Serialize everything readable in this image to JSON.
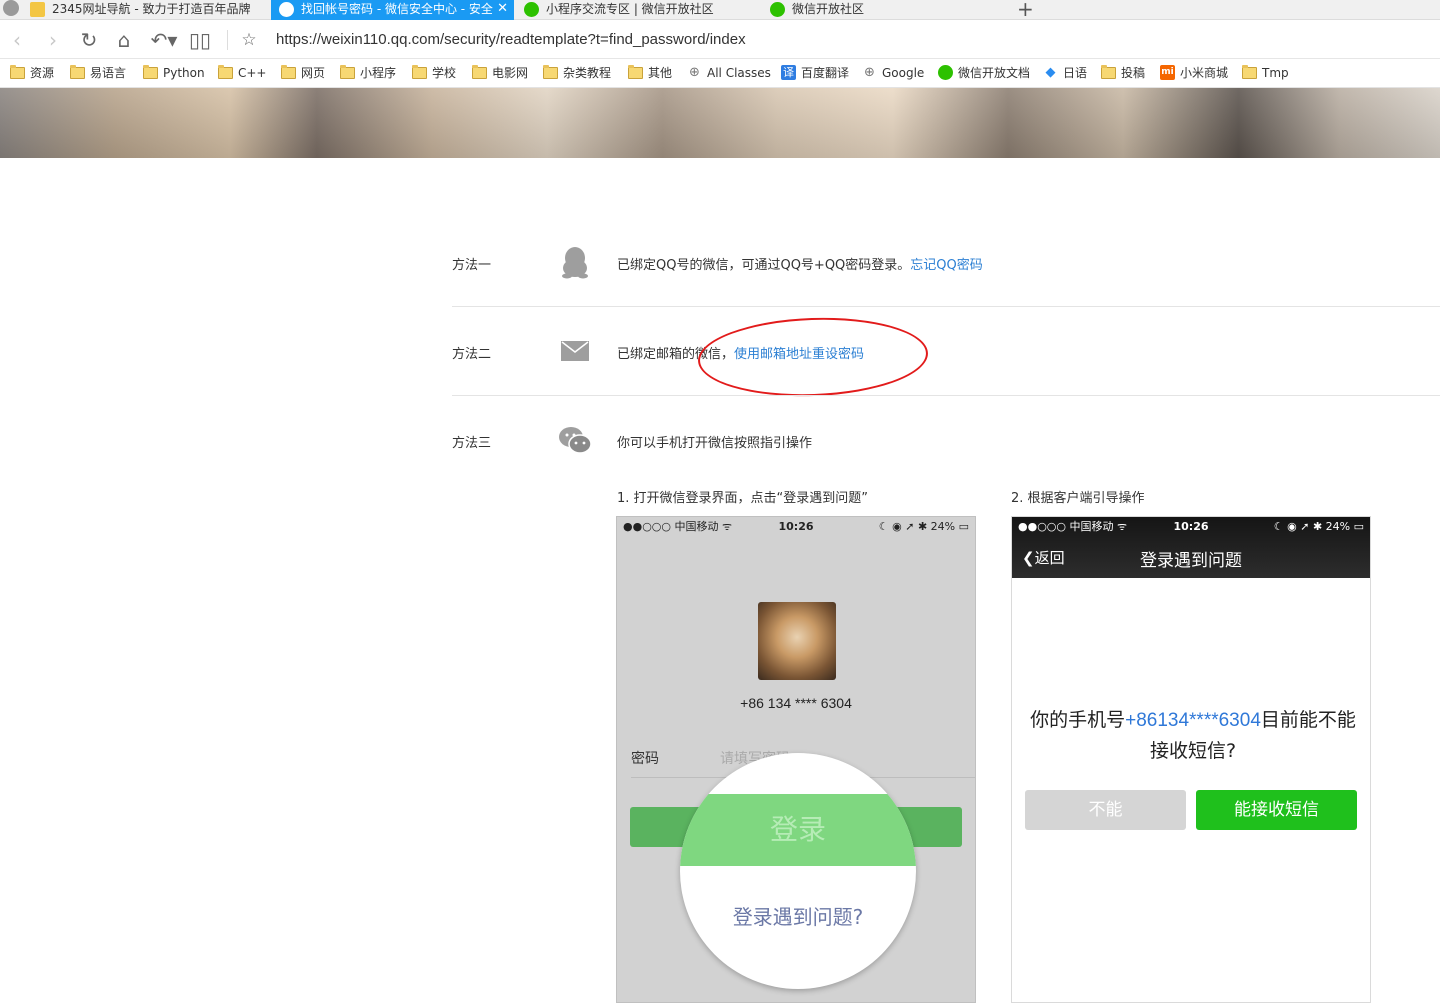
{
  "tabs": [
    {
      "title": "2345网址导航 - 致力于打造百年品牌",
      "active": false
    },
    {
      "title": "找回帐号密码 - 微信安全中心 - 安全",
      "active": true
    },
    {
      "title": "小程序交流专区 | 微信开放社区",
      "active": false
    },
    {
      "title": "微信开放社区",
      "active": false
    }
  ],
  "address": {
    "url": "https://weixin110.qq.com/security/readtemplate?t=find_password/index"
  },
  "bookmarks": [
    {
      "label": "资源",
      "icon": "folder-icon"
    },
    {
      "label": "易语言",
      "icon": "folder-icon"
    },
    {
      "label": "Python",
      "icon": "folder-icon"
    },
    {
      "label": "C++",
      "icon": "folder-icon"
    },
    {
      "label": "网页",
      "icon": "folder-icon"
    },
    {
      "label": "小程序",
      "icon": "folder-icon"
    },
    {
      "label": "学校",
      "icon": "folder-icon"
    },
    {
      "label": "电影网",
      "icon": "folder-icon"
    },
    {
      "label": "杂类教程",
      "icon": "folder-icon"
    },
    {
      "label": "其他",
      "icon": "folder-icon"
    },
    {
      "label": "All Classes",
      "icon": "globe-icon"
    },
    {
      "label": "百度翻译",
      "icon": "translate-icon"
    },
    {
      "label": "Google",
      "icon": "globe-icon"
    },
    {
      "label": "微信开放文档",
      "icon": "wechat-icon"
    },
    {
      "label": "日语",
      "icon": "diamond-icon"
    },
    {
      "label": "投稿",
      "icon": "folder-icon"
    },
    {
      "label": "小米商城",
      "icon": "mi-icon"
    },
    {
      "label": "Tmp",
      "icon": "folder-icon"
    }
  ],
  "methods": [
    {
      "label": "方法一",
      "icon": "qq-penguin-icon",
      "text": "已绑定QQ号的微信，可通过QQ号+QQ密码登录。",
      "link": "忘记QQ密码"
    },
    {
      "label": "方法二",
      "icon": "mail-icon",
      "text": "已绑定邮箱的微信，",
      "link": "使用邮箱地址重设密码"
    },
    {
      "label": "方法三",
      "icon": "wechat-icon",
      "text": "你可以手机打开微信按照指引操作",
      "link": ""
    }
  ],
  "steps": {
    "step1": "1. 打开微信登录界面，点击“登录遇到问题”",
    "step2": "2. 根据客户端引导操作"
  },
  "phone1": {
    "carrier": "●●○○○ 中国移动 ᯤ",
    "time": "10:26",
    "status_right": "☾ ◉ ➚ ✱ 24% ▭",
    "phone_number": "+86 134 **** 6304",
    "password_label": "密码",
    "password_placeholder": "请填写密码",
    "login_button": "登录",
    "trouble_link": "登录遇到问题?"
  },
  "phone2": {
    "carrier": "●●○○○ 中国移动 ᯤ",
    "time": "10:26",
    "status_right": "☾ ◉ ➚ ✱ 24% ▭",
    "back": "返回",
    "title": "登录遇到问题",
    "msg_prefix": "你的手机号",
    "msg_number": "+86134****6304",
    "msg_suffix": "目前能不能接收短信?",
    "btn_no": "不能",
    "btn_yes": "能接收短信"
  },
  "colors": {
    "tab_active": "#1a9af3",
    "link": "#2b7fd3",
    "annotation": "#e21b1b",
    "green": "#1fc01c"
  }
}
